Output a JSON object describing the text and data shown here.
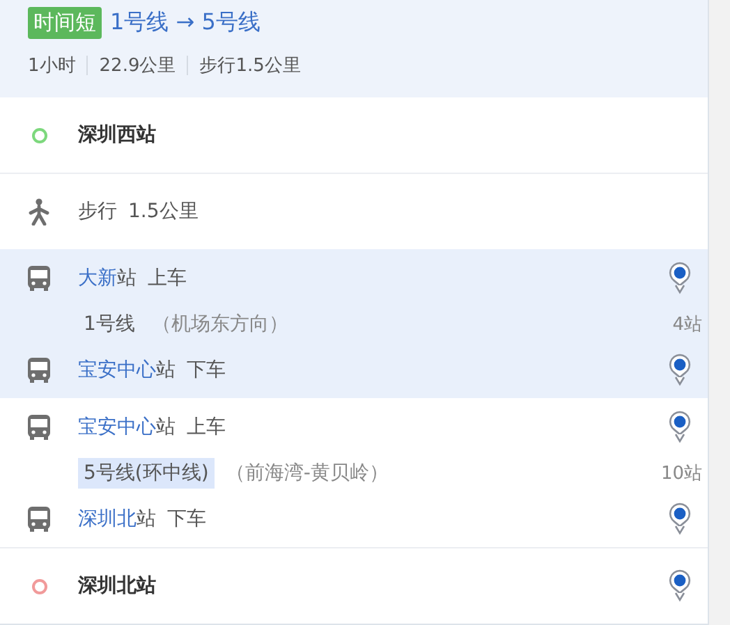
{
  "header": {
    "badge": "时间短",
    "route": "1号线 → 5号线",
    "stats": [
      "1小时",
      "22.9公里",
      "步行1.5公里"
    ]
  },
  "steps": [
    {
      "kind": "start",
      "station": "深圳西站"
    },
    {
      "kind": "walk",
      "label": "步行",
      "distance": "1.5公里"
    },
    {
      "kind": "segment",
      "selected": true,
      "board": {
        "station": "大新",
        "suffix": "站",
        "action": "上车"
      },
      "line": {
        "name": "1号线",
        "highlighted": false,
        "direction": "（机场东方向）",
        "stops": "4站"
      },
      "alight": {
        "station": "宝安中心",
        "suffix": "站",
        "action": "下车"
      }
    },
    {
      "kind": "segment",
      "selected": false,
      "board": {
        "station": "宝安中心",
        "suffix": "站",
        "action": "上车"
      },
      "line": {
        "name": "5号线(环中线)",
        "highlighted": true,
        "direction": "（前海湾-黄贝岭）",
        "stops": "10站"
      },
      "alight": {
        "station": "深圳北",
        "suffix": "站",
        "action": "下车"
      }
    },
    {
      "kind": "end",
      "station": "深圳北站"
    }
  ]
}
